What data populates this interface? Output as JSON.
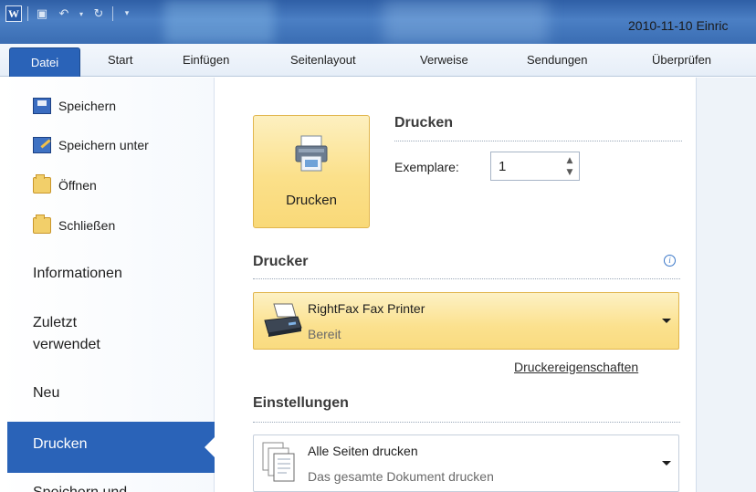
{
  "window": {
    "app_icon_letter": "W",
    "document_title": "2010-11-10 Einric"
  },
  "ribbon": {
    "tabs": [
      "Datei",
      "Start",
      "Einfügen",
      "Seitenlayout",
      "Verweise",
      "Sendungen",
      "Überprüfen"
    ]
  },
  "backstage_nav": {
    "commands": [
      "Speichern",
      "Speichern unter",
      "Öffnen",
      "Schließen"
    ],
    "tabs": {
      "informationen": "Informationen",
      "zuletzt_line1": "Zuletzt",
      "zuletzt_line2": "verwendet",
      "neu": "Neu",
      "drucken": "Drucken",
      "speichern_partial": "Speichern und"
    }
  },
  "print": {
    "button_label": "Drucken",
    "heading": "Drucken",
    "copies_label": "Exemplare:",
    "copies_value": "1"
  },
  "printer": {
    "heading": "Drucker",
    "name": "RightFax Fax Printer",
    "status": "Bereit",
    "properties_link": "Druckereigenschaften"
  },
  "settings": {
    "heading": "Einstellungen",
    "pages_option": "Alle Seiten drucken",
    "pages_description": "Das gesamte Dokument drucken"
  },
  "icons": {
    "info": "info-icon",
    "printer": "printer-icon",
    "fax": "fax-printer-icon",
    "pages": "pages-icon"
  },
  "colors": {
    "accent_blue": "#2a63b8",
    "highlight_yellow": "#fbe08a"
  }
}
